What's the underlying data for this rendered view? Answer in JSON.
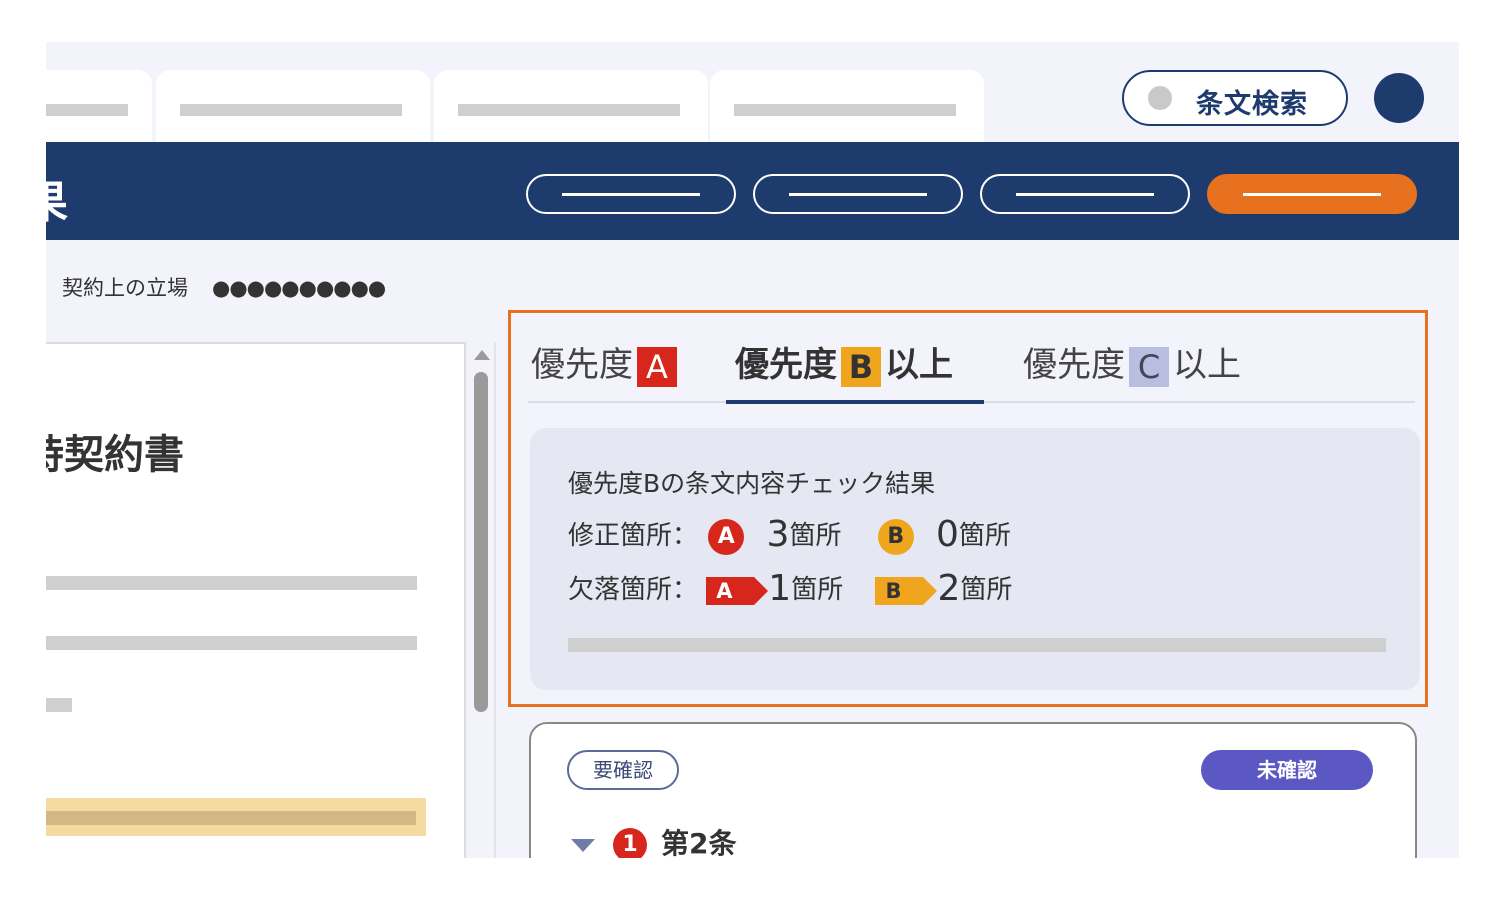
{
  "header": {
    "search_label": "条文検索",
    "cut_title": "果"
  },
  "stance": {
    "label": "契約上の立場",
    "value": "●●●●●●●●●●"
  },
  "document": {
    "title_partial": "持契約書"
  },
  "priority_tabs": [
    {
      "prefix": "優先度",
      "badge": "A",
      "suffix": ""
    },
    {
      "prefix": "優先度",
      "badge": "B",
      "suffix": "以上"
    },
    {
      "prefix": "優先度",
      "badge": "C",
      "suffix": "以上"
    }
  ],
  "summary": {
    "title": "優先度Bの条文内容チェック結果",
    "fix_label": "修正箇所：",
    "fix_a_icon": "A",
    "fix_a_count": "3",
    "fix_b_icon": "B",
    "fix_b_count": "0",
    "missing_label": "欠落箇所：",
    "missing_a_icon": "A",
    "missing_a_count": "1",
    "missing_b_icon": "B",
    "missing_b_count": "2",
    "unit": "箇所"
  },
  "clause_card": {
    "chip_required": "要確認",
    "chip_status": "未確認",
    "number": "1",
    "title": "第2条"
  },
  "colors": {
    "navy": "#1e3b6e",
    "orange": "#e8711f",
    "priority_a": "#d7261b",
    "priority_b": "#f0a51e",
    "priority_c": "#b7bedf",
    "status_purple": "#5b58c4"
  }
}
